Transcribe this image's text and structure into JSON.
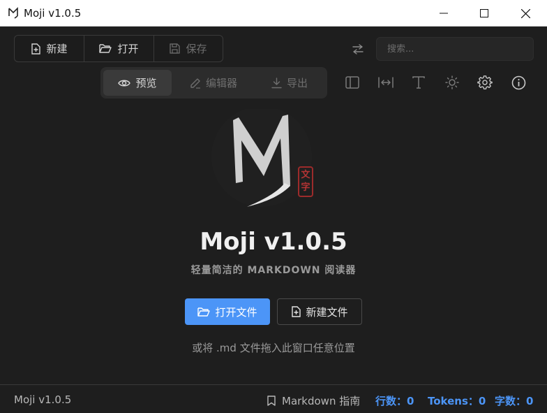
{
  "window": {
    "title": "Moji v1.0.5",
    "minimize_icon": "minimize-icon",
    "maximize_icon": "maximize-icon",
    "close_icon": "close-icon"
  },
  "toolbar": {
    "new_label": "新建",
    "open_label": "打开",
    "save_label": "保存",
    "search_placeholder": "搜索...",
    "modes": {
      "preview": "预览",
      "editor": "编辑器",
      "export": "导出"
    },
    "active_mode": "preview",
    "icons": [
      "swap-icon",
      "sidebar-icon",
      "width-icon",
      "font-icon",
      "theme-icon",
      "settings-icon",
      "info-icon"
    ]
  },
  "welcome": {
    "title": "Moji v1.0.5",
    "subtitle": "轻量简洁的 MARKDOWN 阅读器",
    "seal_top": "文",
    "seal_bottom": "字",
    "open_file_label": "打开文件",
    "new_file_label": "新建文件",
    "hint": "或将 .md 文件拖入此窗口任意位置"
  },
  "status": {
    "version": "Moji v1.0.5",
    "guide_label": "Markdown 指南",
    "lines": "行数：0",
    "tokens": "Tokens：0",
    "chars": "字数：0"
  },
  "colors": {
    "accent": "#4c95f7",
    "background": "#1e1e1e",
    "seal": "#b33434"
  }
}
